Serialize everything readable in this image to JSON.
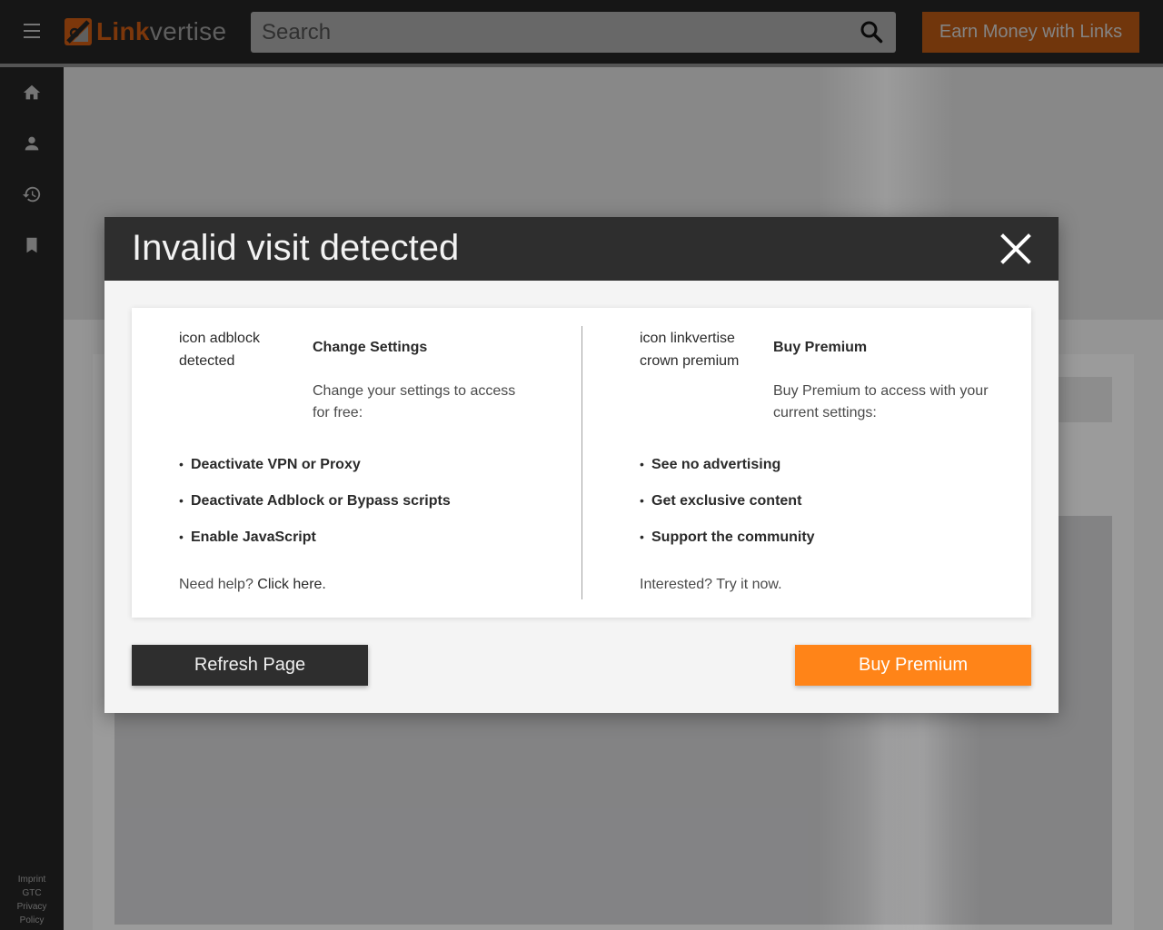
{
  "header": {
    "logo": {
      "brand_part1": "Link",
      "brand_part2": "vertise"
    },
    "search": {
      "placeholder": "Search"
    },
    "earn_button_label": "Earn Money with Links",
    "colors": {
      "bar": "#252525",
      "brand_orange": "#ff8418"
    }
  },
  "sidebar": {
    "items": [
      {
        "icon": "home-icon"
      },
      {
        "icon": "account-icon"
      },
      {
        "icon": "history-icon"
      },
      {
        "icon": "bookmark-icon"
      }
    ],
    "footer_links": [
      "Imprint",
      "GTC",
      "Privacy",
      "Policy"
    ]
  },
  "modal": {
    "title": "Invalid visit detected",
    "left": {
      "icon_alt": "icon adblock detected",
      "heading": "Change Settings",
      "description": "Change your settings to access for free:",
      "bullets": [
        "Deactivate VPN or Proxy",
        "Deactivate Adblock or Bypass scripts",
        "Enable JavaScript"
      ],
      "help_text": "Need help?",
      "help_link": "Click here."
    },
    "right": {
      "icon_alt": "icon linkvertise crown premium",
      "heading": "Buy Premium",
      "description": "Buy Premium to access with your current settings:",
      "bullets": [
        "See no advertising",
        "Get exclusive content",
        "Support the community"
      ],
      "cta_text": "Interested? Try it now."
    },
    "refresh_button": "Refresh Page",
    "buy_button": "Buy Premium"
  }
}
